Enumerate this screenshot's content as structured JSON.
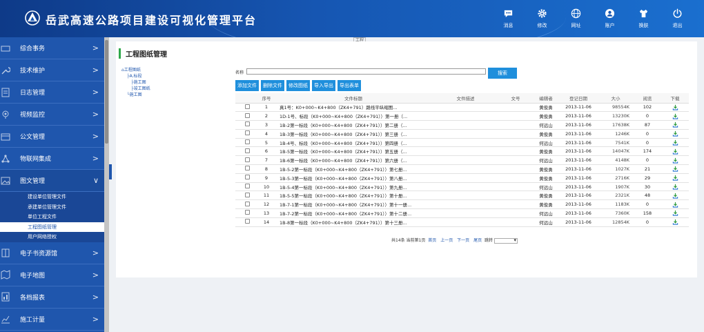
{
  "header": {
    "title": "岳武高速公路项目建设可视化管理平台",
    "tools": [
      {
        "label": "消息",
        "icon": "message-icon"
      },
      {
        "label": "修改",
        "icon": "gear-icon"
      },
      {
        "label": "网址",
        "icon": "globe-icon"
      },
      {
        "label": "账户",
        "icon": "user-icon"
      },
      {
        "label": "换肤",
        "icon": "shirt-icon"
      },
      {
        "label": "退出",
        "icon": "power-icon"
      }
    ]
  },
  "sidebar": {
    "items_top": [
      {
        "label": "综合事务",
        "icon": "desk-icon"
      },
      {
        "label": "技术维护",
        "icon": "wrench-icon"
      },
      {
        "label": "日志管理",
        "icon": "log-icon"
      },
      {
        "label": "视频监控",
        "icon": "camera-icon"
      },
      {
        "label": "公文管理",
        "icon": "document-icon"
      },
      {
        "label": "物联网集成",
        "icon": "network-icon"
      }
    ],
    "open_item": {
      "label": "图文管理",
      "icon": "image-icon"
    },
    "sub_items": [
      "建设单位管理文件",
      "承建单位管理文件",
      "单位工程文件",
      "工程图纸管理",
      "用户网络授权"
    ],
    "active_sub": 3,
    "items_bottom": [
      {
        "label": "电子书资源馆",
        "icon": "book-icon"
      },
      {
        "label": "电子地图",
        "icon": "map-icon"
      },
      {
        "label": "各档报表",
        "icon": "report-icon"
      },
      {
        "label": "施工计量",
        "icon": "chart-icon"
      }
    ]
  },
  "content": {
    "broken_image_alt": "工程",
    "title": "工程图纸管理",
    "tree": [
      "工程图纸",
      "A.标段",
      "施工图",
      "竣工图纸",
      "施工图"
    ],
    "search": {
      "label": "名称",
      "placeholder": "",
      "value": "",
      "button": "搜索"
    },
    "actions": [
      "添加文件",
      "删除文件",
      "修改图纸",
      "导入导出",
      "导出表单"
    ],
    "columns": [
      "",
      "序号",
      "文件标题",
      "文件描述",
      "文号",
      "编辑者",
      "登记日期",
      "大小",
      "阅览",
      "下载"
    ],
    "rows": [
      {
        "no": "1",
        "title": "真1号：K0+000~K4+800（ZK4+791）路线平纵缩图...",
        "desc": "",
        "docno": "",
        "editor": "黄俊勇",
        "date": "2013-11-06",
        "size": "98554K",
        "views": "102"
      },
      {
        "no": "2",
        "title": "1D-1号、标段（K0+000~K4+800（ZK4+791））第一册（...",
        "desc": "",
        "docno": "",
        "editor": "黄俊勇",
        "date": "2013-11-06",
        "size": "13230K",
        "views": "0"
      },
      {
        "no": "3",
        "title": "1B-2第一标段（K0+000~K4+800（ZK4+791））第二册（...",
        "desc": "",
        "docno": "",
        "editor": "何远山",
        "date": "2013-11-06",
        "size": "17638K",
        "views": "87"
      },
      {
        "no": "4",
        "title": "1B-3第一标段（K0+000~K4+800（ZK4+791））第三册（...",
        "desc": "",
        "docno": "",
        "editor": "黄俊勇",
        "date": "2013-11-06",
        "size": "1246K",
        "views": "0"
      },
      {
        "no": "5",
        "title": "1B-4号、标段（K0+000~K4+800（ZK4+791））第四册（...",
        "desc": "",
        "docno": "",
        "editor": "何远山",
        "date": "2013-11-06",
        "size": "7541K",
        "views": "0"
      },
      {
        "no": "6",
        "title": "1B-5第一标段（K0+000~K4+800（ZK4+791））第五册（...",
        "desc": "",
        "docno": "",
        "editor": "黄俊勇",
        "date": "2013-11-06",
        "size": "14047K",
        "views": "174"
      },
      {
        "no": "7",
        "title": "1B-6第一标段（K0+000~K4+800（ZK4+791））第六册（...",
        "desc": "",
        "docno": "",
        "editor": "何远山",
        "date": "2013-11-06",
        "size": "4148K",
        "views": "0"
      },
      {
        "no": "8",
        "title": "1B-5-2第一标段（K0+000~K4+800（ZK4+791））第七册...",
        "desc": "",
        "docno": "",
        "editor": "黄俊勇",
        "date": "2013-11-06",
        "size": "1027K",
        "views": "21"
      },
      {
        "no": "9",
        "title": "1B-5-3第一标段（K0+000~K4+800（ZK4+791））第八册...",
        "desc": "",
        "docno": "",
        "editor": "黄俊勇",
        "date": "2013-11-06",
        "size": "2716K",
        "views": "29"
      },
      {
        "no": "10",
        "title": "1B-5-4第一标段（K0+000~K4+800（ZK4+791））第九册...",
        "desc": "",
        "docno": "",
        "editor": "何远山",
        "date": "2013-11-06",
        "size": "1907K",
        "views": "30"
      },
      {
        "no": "11",
        "title": "1B-5-5第一标段（K0+000~K4+800（ZK4+791））第十册...",
        "desc": "",
        "docno": "",
        "editor": "黄俊勇",
        "date": "2013-11-06",
        "size": "2321K",
        "views": "48"
      },
      {
        "no": "12",
        "title": "1B-7-1第一标段（K0+000~K4+800（ZK4+791））第十一册...",
        "desc": "",
        "docno": "",
        "editor": "黄俊勇",
        "date": "2013-11-06",
        "size": "1183K",
        "views": "0"
      },
      {
        "no": "13",
        "title": "1B-7-2第一标段（K0+000~K4+800（ZK4+791））第十二册...",
        "desc": "",
        "docno": "",
        "editor": "何远山",
        "date": "2013-11-06",
        "size": "7360K",
        "views": "158"
      },
      {
        "no": "14",
        "title": "1B-8第一标段（K0+000~K4+800（ZK4+791））第十三册...",
        "desc": "",
        "docno": "",
        "editor": "何远山",
        "date": "2013-11-06",
        "size": "12854K",
        "views": "0"
      }
    ],
    "pager": {
      "info": "共14条 当前第1页",
      "first": "首页",
      "prev": "上一页",
      "next": "下一页",
      "last": "尾页",
      "jump": "跳转"
    }
  },
  "colors": {
    "header": "#1656b2",
    "sidebar": "#1f56ad",
    "button": "#1f8fdc",
    "title_bar": "#2ea84a"
  }
}
